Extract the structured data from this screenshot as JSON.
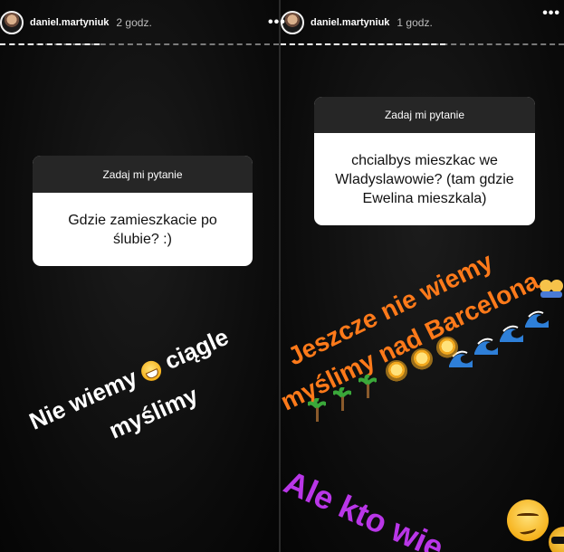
{
  "left_story": {
    "username": "daniel.martyniuk",
    "time": "2 godz.",
    "more_icon": "•••",
    "question_header": "Zadaj mi pytanie",
    "question_text": "Gdzie zamieszkacie po ślubie? :)",
    "caption_line1": "Nie wiemy",
    "caption_line1_after": "ciągle",
    "caption_line2": "myślimy",
    "emoji": "grinning-face"
  },
  "right_story": {
    "username": "daniel.martyniuk",
    "time": "1 godz.",
    "more_icon": "•••",
    "question_header": "Zadaj mi pytanie",
    "question_text": "chcialbys mieszkac we Wladyslawowie? (tam gdzie Ewelina mieszkala)",
    "caption_orange_line1": "Jeszcze nie wiemy",
    "caption_orange_line2": "myślimy nad Barcelona",
    "caption_purple": "Ale kto wie",
    "emojis": [
      "couple",
      "wave",
      "sun",
      "palm-tree",
      "smirking-face",
      "sunglasses-face"
    ]
  },
  "colors": {
    "orange": "#ff7a1a",
    "purple": "#b936e8",
    "question_header_bg": "#262626"
  }
}
